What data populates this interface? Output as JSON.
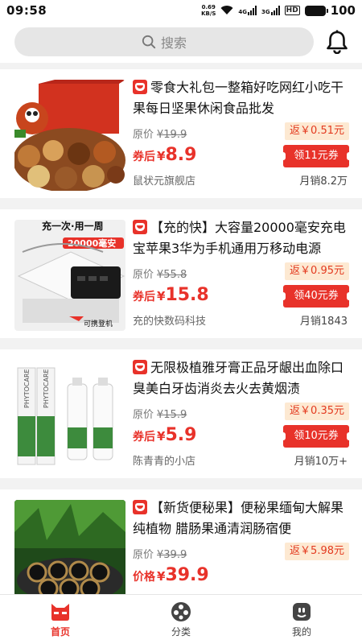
{
  "status_bar": {
    "time": "09:58",
    "net_speed_value": "0.69",
    "net_speed_unit": "KB/S",
    "signal1_label": "4G",
    "signal2_label": "3G",
    "hd_label": "HD",
    "battery": "100"
  },
  "search": {
    "placeholder": "搜索",
    "icon": "search-icon"
  },
  "header": {
    "bell_icon": "bell-icon"
  },
  "products": [
    {
      "title": "零食大礼包一整箱好吃网红小吃干果每日坚果休闲食品批发",
      "orig_label": "原价",
      "orig_price": "¥19.9",
      "rebate": "返￥0.51元",
      "price_tag": "券后",
      "price_yen": "¥",
      "price": "8.9",
      "coupon": "领11元券",
      "shop": "鼠状元旗舰店",
      "sales": "月销8.2万"
    },
    {
      "title": "【充的快】大容量20000毫安充电宝苹果3华为手机通用万移动电源",
      "orig_label": "原价",
      "orig_price": "¥55.8",
      "rebate": "返￥0.95元",
      "price_tag": "券后",
      "price_yen": "¥",
      "price": "15.8",
      "coupon": "领40元券",
      "shop": "充的快数码科技",
      "sales": "月销1843",
      "image_text_top": "充一次·用一周",
      "image_text_badge": "20000毫安",
      "image_text_bottom": "可携登机"
    },
    {
      "title": "无限极植雅牙膏正品牙龈出血除口臭美白牙齿消炎去火去黄烟渍",
      "orig_label": "原价",
      "orig_price": "¥15.9",
      "rebate": "返￥0.35元",
      "price_tag": "券后",
      "price_yen": "¥",
      "price": "5.9",
      "coupon": "领10元券",
      "shop": "陈青青的小店",
      "sales": "月销10万+",
      "image_text_brand": "PHYTOCARE"
    },
    {
      "title": "【新货便秘果】便秘果缅甸大解果纯植物 腊肠果通清润肠宿便",
      "orig_label": "原价",
      "orig_price": "¥39.9",
      "rebate": "返￥5.98元",
      "price_tag": "价格",
      "price_yen": "¥",
      "price": "39.9"
    }
  ],
  "tabbar": {
    "items": [
      {
        "label": "首页",
        "icon": "home-cat-icon",
        "active": true
      },
      {
        "label": "分类",
        "icon": "category-dots-icon",
        "active": false
      },
      {
        "label": "我的",
        "icon": "profile-icon",
        "active": false
      }
    ]
  },
  "colors": {
    "accent": "#e8322a",
    "rebate_bg": "#fde9d2",
    "search_bg": "#e6e6e6"
  }
}
